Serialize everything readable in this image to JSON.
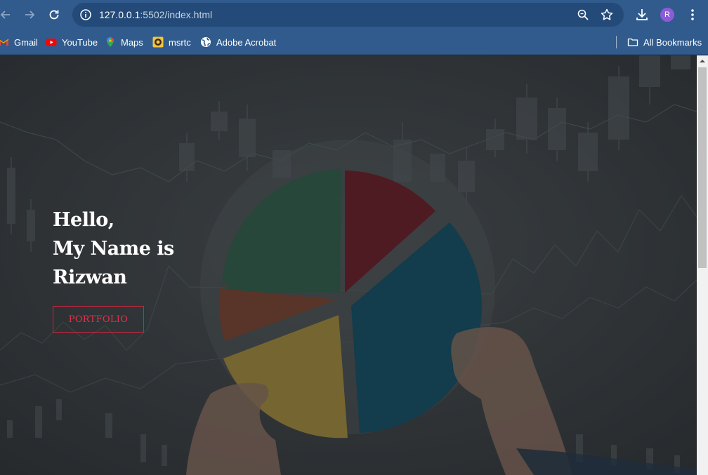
{
  "browser": {
    "url_host": "127.0.0.1",
    "url_rest": ":5502/index.html",
    "profile_initial": "R"
  },
  "bookmarks": {
    "items": [
      {
        "label": "Gmail",
        "icon": "gmail-icon"
      },
      {
        "label": "YouTube",
        "icon": "youtube-icon"
      },
      {
        "label": "Maps",
        "icon": "maps-icon"
      },
      {
        "label": "msrtc",
        "icon": "msrtc-icon"
      },
      {
        "label": "Adobe Acrobat",
        "icon": "globe-icon"
      }
    ],
    "all_label": "All Bookmarks"
  },
  "hero": {
    "line1": "Hello,",
    "line2": "My Name is",
    "line3": "Rizwan",
    "button_label": "PORTFOLIO"
  },
  "colors": {
    "chrome": "#315b8c",
    "omnibox": "#234a78",
    "accent": "#d0243f",
    "pie_green": "#2c5c48",
    "pie_red": "#6b1a24",
    "pie_orange": "#7a3f2c",
    "pie_yellow": "#a58a3a",
    "pie_teal": "#0f4c63"
  }
}
